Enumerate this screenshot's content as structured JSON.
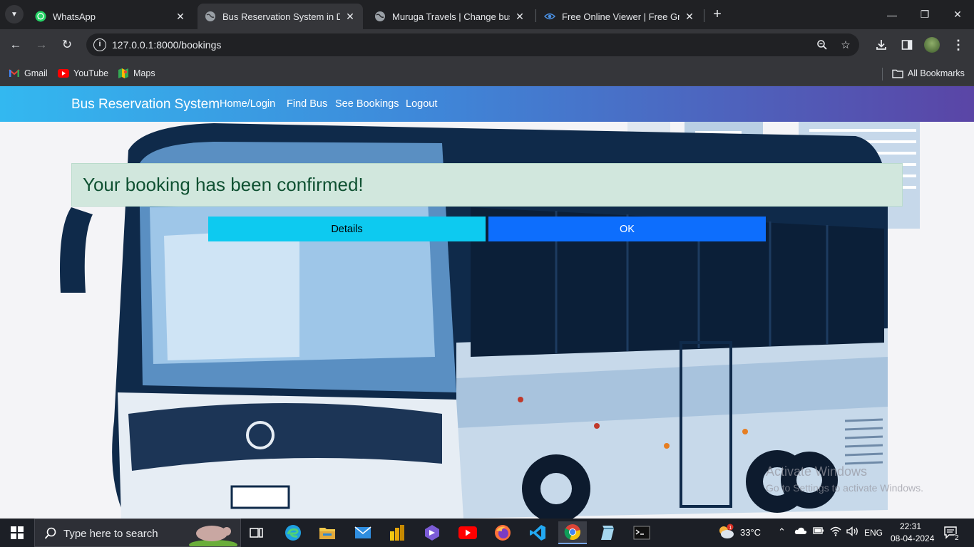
{
  "browser": {
    "tabs": [
      {
        "title": "WhatsApp",
        "icon": "whatsapp-icon"
      },
      {
        "title": "Bus Reservation System in Djang",
        "icon": "globe-icon"
      },
      {
        "title": "Muruga Travels | Change bus | D",
        "icon": "globe-icon"
      },
      {
        "title": "Free Online Viewer | Free Group",
        "icon": "eye-icon"
      }
    ],
    "url": "127.0.0.1:8000/bookings",
    "bookmarks": [
      {
        "label": "Gmail",
        "icon": "gmail-icon"
      },
      {
        "label": "YouTube",
        "icon": "youtube-icon"
      },
      {
        "label": "Maps",
        "icon": "maps-icon"
      }
    ],
    "all_bookmarks": "All Bookmarks"
  },
  "page": {
    "brand": "Bus Reservation System",
    "nav": [
      "Home/Login",
      "Find Bus",
      "See Bookings",
      "Logout"
    ],
    "alert": "Your booking has been confirmed!",
    "details_button": "Details",
    "ok_button": "OK",
    "watermark_title": "Activate Windows",
    "watermark_sub": "Go to Settings to activate Windows."
  },
  "taskbar": {
    "search_placeholder": "Type here to search",
    "weather": "33°C",
    "language": "ENG",
    "time": "22:31",
    "date": "08-04-2024",
    "notification_count": "2"
  },
  "colors": {
    "navbar_start": "#33b8f0",
    "navbar_end": "#5a45a6",
    "alert_bg": "#d1e7dd",
    "alert_text": "#0f5132",
    "details_bg": "#0dcaf0",
    "ok_bg": "#0d6efd"
  }
}
